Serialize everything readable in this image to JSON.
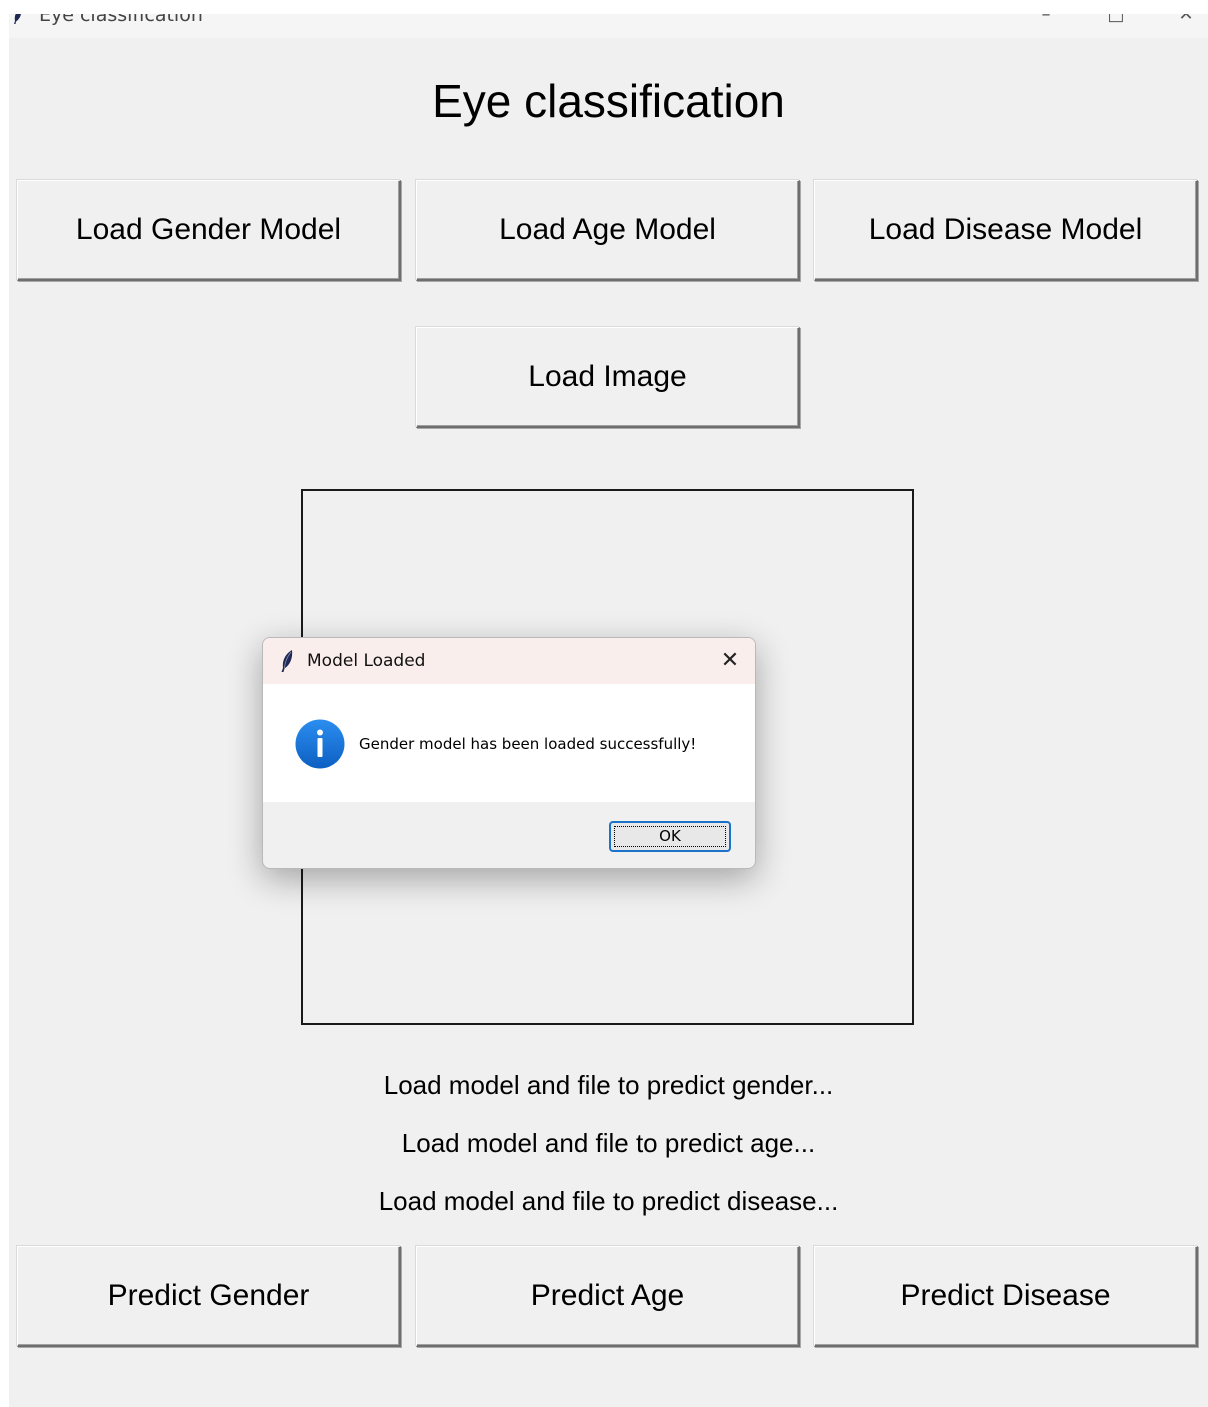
{
  "window": {
    "title": "Eye classification",
    "controls": {
      "minimize": "–",
      "maximize": "□",
      "close": "✕"
    }
  },
  "heading": "Eye classification",
  "load_buttons": {
    "gender": "Load Gender Model",
    "age": "Load Age Model",
    "disease": "Load Disease Model",
    "image": "Load Image"
  },
  "status": {
    "gender": "Load model and file to predict gender...",
    "age": "Load model and file to predict age...",
    "disease": "Load model and file to predict disease..."
  },
  "predict_buttons": {
    "gender": "Predict Gender",
    "age": "Predict Age",
    "disease": "Predict Disease"
  },
  "dialog": {
    "title": "Model Loaded",
    "message": "Gender model has been loaded successfully!",
    "ok_label": "OK",
    "close_glyph": "✕",
    "icon": "info-icon"
  },
  "colors": {
    "window_bg": "#f0f0f0",
    "info_blue": "#1a73d9",
    "dialog_title_bg": "#faeeec",
    "ok_border": "#1b72c8"
  }
}
